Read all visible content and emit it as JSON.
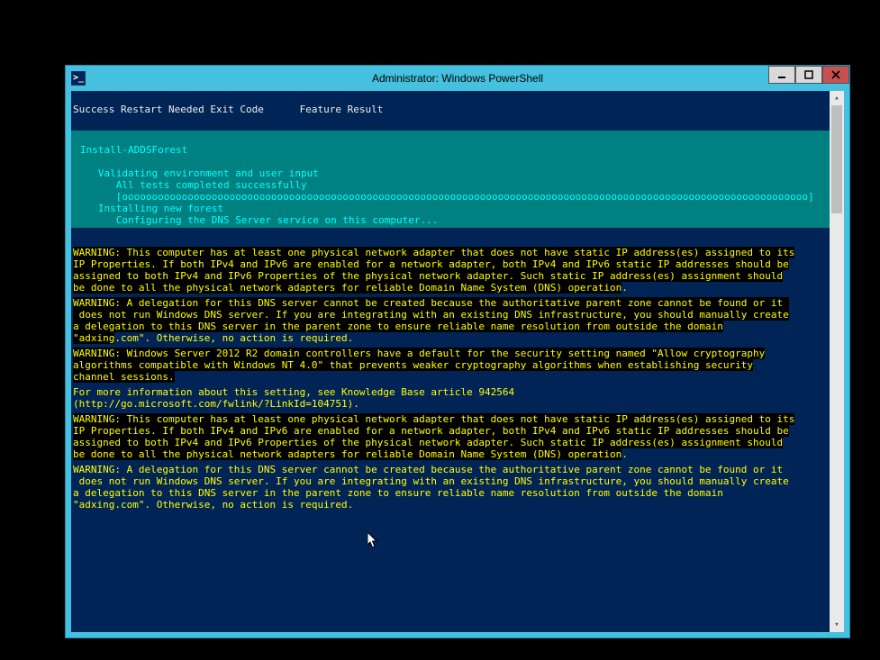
{
  "window": {
    "title": "Administrator: Windows PowerShell",
    "icon_glyph": ">_"
  },
  "header_line": "Success Restart Needed Exit Code      Feature Result",
  "progress": {
    "cmd": "Install-ADDSForest",
    "l1": "Validating environment and user input",
    "l2": "All tests completed successfully",
    "bar": "[ooooooooooooooooooooooooooooooooooooooooooooooooooooooooooooooooooooooooooooooooooooooooooooooooooooooooooooooooooo]",
    "l3": "Installing new forest",
    "l4": "Configuring the DNS Server service on this computer..."
  },
  "warnings": {
    "w1": "WARNING: This computer has at least one physical network adapter that does not have static IP address(es) assigned to its IP Properties. If both IPv4 and IPv6 are enabled for a network adapter, both IPv4 and IPv6 static IP addresses should be assigned to both IPv4 and IPv6 Properties of the physical network adapter. Such static IP address(es) assignment should be done to all the physical network adapters for reliable Domain Name System (DNS) operation.",
    "w2": "WARNING: A delegation for this DNS server cannot be created because the authoritative parent zone cannot be found or it  does not run Windows DNS server. If you are integrating with an existing DNS infrastructure, you should manually create a delegation to this DNS server in the parent zone to ensure reliable name resolution from outside the domain \"adxing.com\". Otherwise, no action is required.",
    "w3": "WARNING: Windows Server 2012 R2 domain controllers have a default for the security setting named \"Allow cryptography algorithms compatible with Windows NT 4.0\" that prevents weaker cryptography algorithms when establishing security channel sessions.",
    "info": "For more information about this setting, see Knowledge Base article 942564 (http://go.microsoft.com/fwlink/?LinkId=104751).",
    "w4": "WARNING: This computer has at least one physical network adapter that does not have static IP address(es) assigned to its IP Properties. If both IPv4 and IPv6 are enabled for a network adapter, both IPv4 and IPv6 static IP addresses should be assigned to both IPv4 and IPv6 Properties of the physical network adapter. Such static IP address(es) assignment should be done to all the physical network adapters for reliable Domain Name System (DNS) operation.",
    "w5": "WARNING: A delegation for this DNS server cannot be created because the authoritative parent zone cannot be found or it  does not run Windows DNS server. If you are integrating with an existing DNS infrastructure, you should manually create a delegation to this DNS server in the parent zone to ensure reliable name resolution from outside the domain \"adxing.com\". Otherwise, no action is required."
  }
}
